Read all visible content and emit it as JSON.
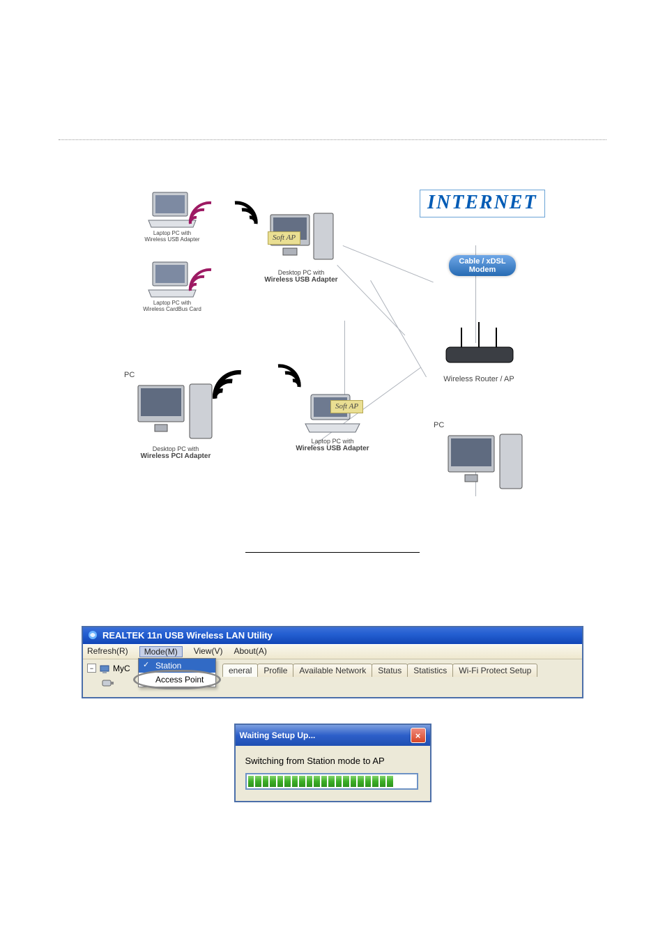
{
  "diagram": {
    "dev1_line1": "Laptop PC with",
    "dev1_line2": "Wireless USB Adapter",
    "dev2_line1": "Laptop PC with",
    "dev2_line2": "Wireless CardBus Card",
    "dev3_label": "PC",
    "dev3_line1": "Desktop PC with",
    "dev3_line2": "Wireless PCI Adapter",
    "softap_sticker1": "Soft AP",
    "softap_line1": "Desktop PC with",
    "softap_line2": "Wireless USB Adapter",
    "softap_sticker2": "Soft AP",
    "softap2_line1": "Laptop PC with",
    "softap2_line2": "Wireless USB Adapter",
    "internet_label": "INTERNET",
    "modem_line1": "Cable / xDSL",
    "modem_line2": "Modem",
    "router_label": "Wireless Router / AP",
    "pc_label": "PC"
  },
  "util": {
    "title": "REALTEK 11n USB Wireless LAN Utility",
    "menu": {
      "refresh": "Refresh(R)",
      "mode": "Mode(M)",
      "view": "View(V)",
      "about": "About(A)"
    },
    "tree": {
      "root": "MyC",
      "child_icon_name": "usb-device-icon"
    },
    "mode_menu": {
      "station": "Station",
      "ap": "Access Point"
    },
    "tabs": {
      "general_truncated": "eneral",
      "profile": "Profile",
      "available": "Available Network",
      "status": "Status",
      "stats": "Statistics",
      "wifi": "Wi-Fi Protect Setup"
    }
  },
  "wait_dialog": {
    "title": "Waiting Setup Up...",
    "close": "×",
    "body": "Switching from Station mode to AP",
    "filled_segments": 20,
    "total_segments": 23
  }
}
